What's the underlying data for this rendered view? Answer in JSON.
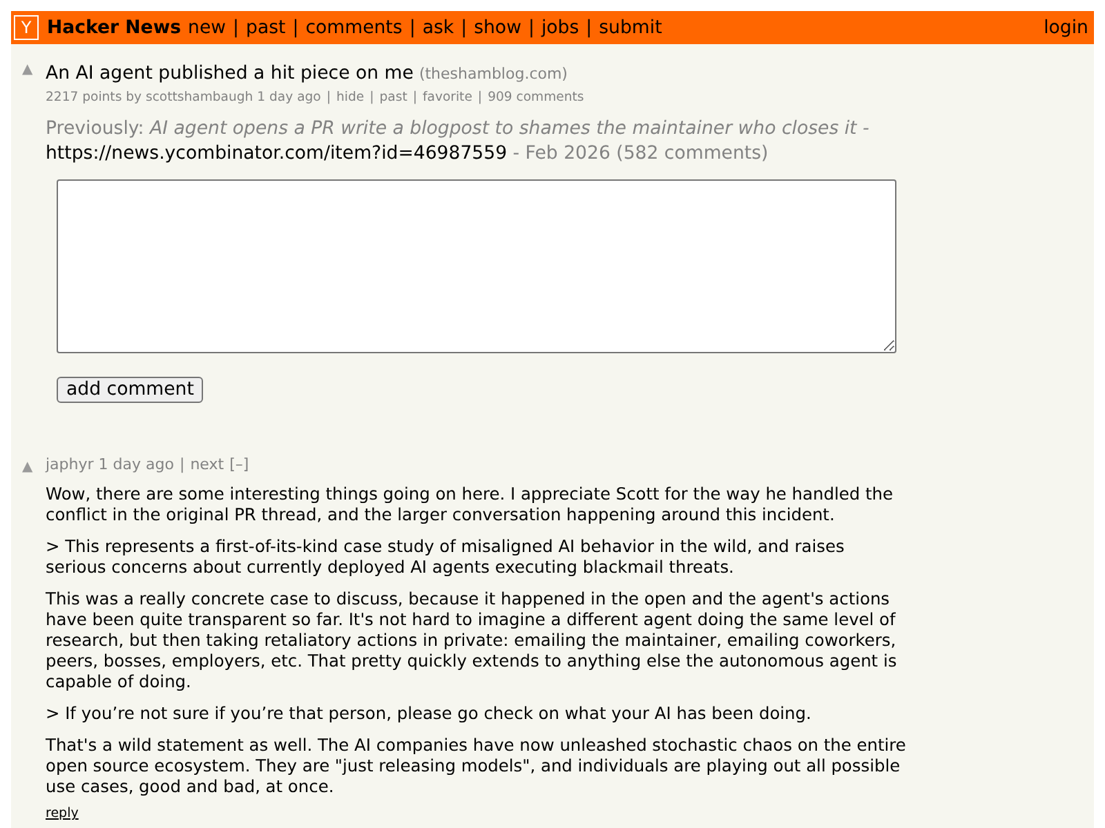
{
  "header": {
    "logo": "Y",
    "site_name": "Hacker News",
    "nav": [
      "new",
      "past",
      "comments",
      "ask",
      "show",
      "jobs",
      "submit"
    ],
    "separator": "|",
    "login": "login"
  },
  "story": {
    "vote": "▲",
    "title": "An AI agent published a hit piece on me",
    "site": "(theshamblog.com)",
    "subline": [
      {
        "text": "2217 points by scottshambaugh 1 day ago"
      },
      {
        "text": "hide"
      },
      {
        "text": "past"
      },
      {
        "text": "favorite"
      },
      {
        "text": "909 comments"
      }
    ],
    "subline_separator": "|",
    "previously_label": "Previously:",
    "previously_title": "AI agent opens a PR write a blogpost to shames the maintainer who closes it -",
    "previously_url": "https://news.ycombinator.com/item?id=46987559",
    "previously_meta": "- Feb 2026 (582 comments)"
  },
  "comment_form": {
    "button": "add comment"
  },
  "comments": [
    {
      "vote": "▲",
      "meta": "japhyr 1 day ago",
      "separator": "|",
      "next": "next",
      "toggle": "[–]",
      "paragraphs": [
        "Wow, there are some interesting things going on here. I appreciate Scott for the way he handled the conflict in the original PR thread, and the larger conversation happening around this incident.",
        "> This represents a first-of-its-kind case study of misaligned AI behavior in the wild, and raises serious concerns about currently deployed AI agents executing blackmail threats.",
        "This was a really concrete case to discuss, because it happened in the open and the agent's actions have been quite transparent so far. It's not hard to imagine a different agent doing the same level of research, but then taking retaliatory actions in private: emailing the maintainer, emailing coworkers, peers, bosses, employers, etc. That pretty quickly extends to anything else the autonomous agent is capable of doing.",
        "> If you’re not sure if you’re that person, please go check on what your AI has been doing.",
        "That's a wild statement as well. The AI companies have now unleashed stochastic chaos on the entire open source ecosystem. They are \"just releasing models\", and individuals are playing out all possible use cases, good and bad, at once."
      ],
      "reply": "reply"
    }
  ]
}
